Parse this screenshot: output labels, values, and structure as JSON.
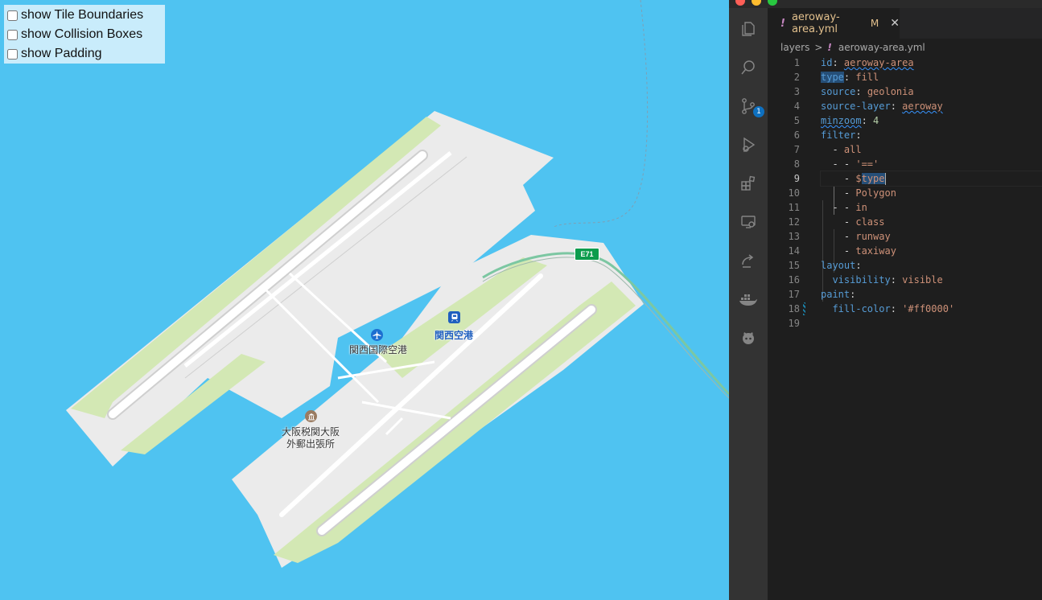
{
  "debug_panel": {
    "options": [
      {
        "label": "show Tile Boundaries",
        "checked": false
      },
      {
        "label": "show Collision Boxes",
        "checked": false
      },
      {
        "label": "show Padding",
        "checked": false
      }
    ]
  },
  "map": {
    "labels": {
      "airport": "関西国際空港",
      "station": "関西空港",
      "customs": "大阪税関大阪\n外郵出張所",
      "route_shield": "E71"
    },
    "colors": {
      "water": "#4fc3f1",
      "land": "#ebebeb",
      "grass": "#d3e8b4",
      "runway": "#ffffff"
    }
  },
  "editor": {
    "tab": {
      "icon": "!",
      "filename": "aeroway-area.yml",
      "status": "M",
      "close": "✕"
    },
    "breadcrumb": {
      "folder": "layers",
      "separator": ">",
      "icon": "!",
      "file": "aeroway-area.yml"
    },
    "scm_badge": "1",
    "line_numbers": [
      "1",
      "2",
      "3",
      "4",
      "5",
      "6",
      "7",
      "8",
      "9",
      "10",
      "11",
      "12",
      "13",
      "14",
      "15",
      "16",
      "17",
      "18",
      "19"
    ],
    "active_line": "9",
    "lines": [
      [
        {
          "t": "id",
          "c": "k"
        },
        {
          "t": ": ",
          "c": "p"
        },
        {
          "t": "aeroway-area",
          "c": "s sq"
        }
      ],
      [
        {
          "t": "type",
          "c": "k sel"
        },
        {
          "t": ": ",
          "c": "p"
        },
        {
          "t": "fill",
          "c": "s"
        }
      ],
      [
        {
          "t": "source",
          "c": "k"
        },
        {
          "t": ": ",
          "c": "p"
        },
        {
          "t": "geolonia",
          "c": "s"
        }
      ],
      [
        {
          "t": "source-layer",
          "c": "k"
        },
        {
          "t": ": ",
          "c": "p"
        },
        {
          "t": "aeroway",
          "c": "s sq"
        }
      ],
      [
        {
          "t": "minzoom",
          "c": "k sq"
        },
        {
          "t": ": ",
          "c": "p"
        },
        {
          "t": "4",
          "c": "n"
        }
      ],
      [
        {
          "t": "filter",
          "c": "k"
        },
        {
          "t": ":",
          "c": "p"
        }
      ],
      [
        {
          "t": "  - ",
          "c": "p"
        },
        {
          "t": "all",
          "c": "s"
        }
      ],
      [
        {
          "t": "  - - ",
          "c": "p"
        },
        {
          "t": "'=='",
          "c": "s"
        }
      ],
      [
        {
          "t": "    - ",
          "c": "p"
        },
        {
          "t": "$",
          "c": "s"
        },
        {
          "t": "type",
          "c": "s sel"
        }
      ],
      [
        {
          "t": "    - ",
          "c": "p"
        },
        {
          "t": "Polygon",
          "c": "s"
        }
      ],
      [
        {
          "t": "  - - ",
          "c": "p"
        },
        {
          "t": "in",
          "c": "s"
        }
      ],
      [
        {
          "t": "    - ",
          "c": "p"
        },
        {
          "t": "class",
          "c": "s"
        }
      ],
      [
        {
          "t": "    - ",
          "c": "p"
        },
        {
          "t": "runway",
          "c": "s"
        }
      ],
      [
        {
          "t": "    - ",
          "c": "p"
        },
        {
          "t": "taxiway",
          "c": "s"
        }
      ],
      [
        {
          "t": "layout",
          "c": "k"
        },
        {
          "t": ":",
          "c": "p"
        }
      ],
      [
        {
          "t": "  ",
          "c": "p"
        },
        {
          "t": "visibility",
          "c": "k"
        },
        {
          "t": ": ",
          "c": "p"
        },
        {
          "t": "visible",
          "c": "s"
        }
      ],
      [
        {
          "t": "paint",
          "c": "k"
        },
        {
          "t": ":",
          "c": "p"
        }
      ],
      [
        {
          "t": "  ",
          "c": "p"
        },
        {
          "t": "fill-color",
          "c": "k"
        },
        {
          "t": ": ",
          "c": "p"
        },
        {
          "t": "'#ff0000'",
          "c": "s"
        }
      ],
      []
    ],
    "activity_icons": [
      "files-icon",
      "search-icon",
      "source-control-icon",
      "run-debug-icon",
      "extensions-icon",
      "remote-explorer-icon",
      "live-share-icon",
      "docker-icon",
      "github-icon"
    ],
    "colors": {
      "background": "#1e1e1e",
      "activity_bar": "#333333",
      "keyword": "#569cd6",
      "string": "#ce9178",
      "number": "#b5cea8"
    }
  }
}
